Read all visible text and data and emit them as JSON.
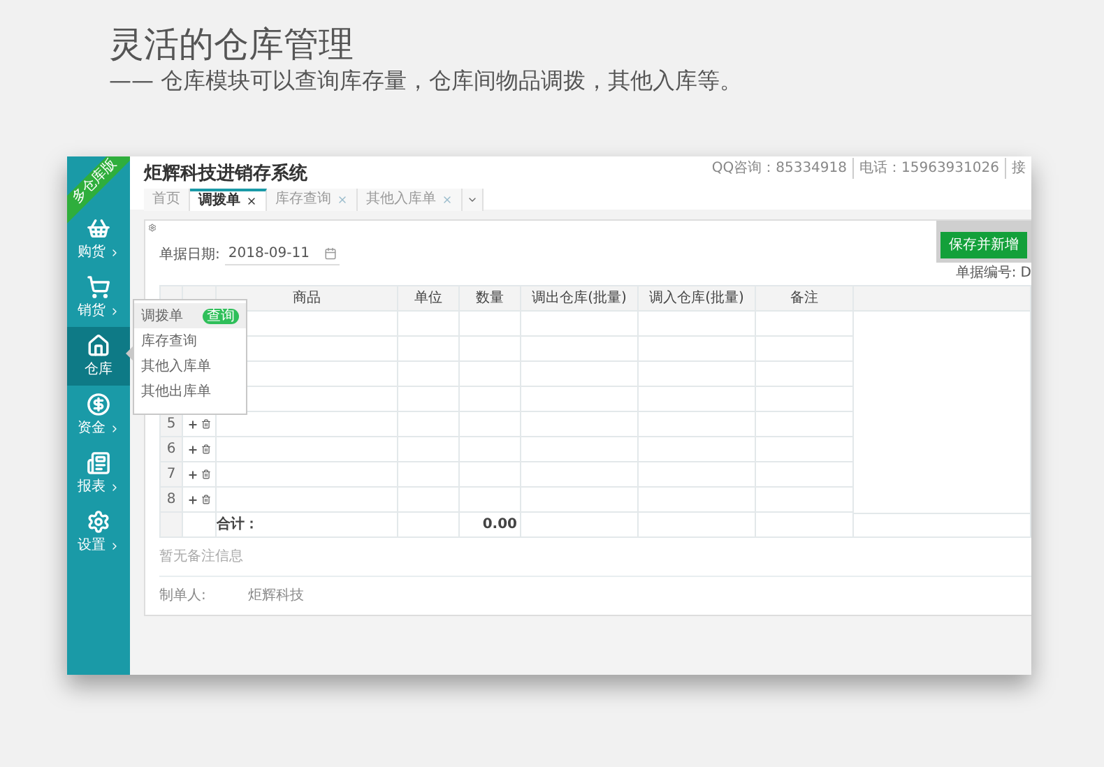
{
  "header": {
    "title": "灵活的仓库管理",
    "subtitle": "—— 仓库模块可以查询库存量，仓库间物品调拨，其他入库等。"
  },
  "app": {
    "badge": "多仓库版",
    "title": "炬辉科技进销存系统",
    "contacts": [
      "QQ咨询：85334918",
      "电话：15963931026",
      "接"
    ]
  },
  "sidebar": [
    {
      "label": "购货",
      "kind": "basket",
      "selected": false
    },
    {
      "label": "销货",
      "kind": "cart",
      "selected": false
    },
    {
      "label": "仓库",
      "kind": "house",
      "selected": true
    },
    {
      "label": "资金",
      "kind": "money",
      "selected": false
    },
    {
      "label": "报表",
      "kind": "report",
      "selected": false
    },
    {
      "label": "设置",
      "kind": "settings",
      "selected": false
    }
  ],
  "menu": [
    {
      "label": "调拨单",
      "selected": true,
      "badge": "查询"
    },
    {
      "label": "库存查询",
      "selected": false
    },
    {
      "label": "其他入库单",
      "selected": false
    },
    {
      "label": "其他出库单",
      "selected": false
    }
  ],
  "tabs": [
    {
      "label": "首页",
      "selected": false,
      "closable": false
    },
    {
      "label": "调拨单",
      "selected": true,
      "closable": true
    },
    {
      "label": "库存查询",
      "selected": false,
      "closable": true
    },
    {
      "label": "其他入库单",
      "selected": false,
      "closable": true
    }
  ],
  "form": {
    "date_label": "单据日期:",
    "date": "2018-09-11",
    "save_button": "保存并新增",
    "number_label": "单据编号:",
    "number": "D"
  },
  "table": {
    "columns": [
      "商品",
      "单位",
      "数量",
      "调出仓库(批量)",
      "调入仓库(批量)",
      "备注"
    ],
    "rows": [
      {
        "kind": "covered"
      },
      {
        "kind": "covered"
      },
      {
        "kind": "covered"
      },
      {
        "kind": "covered"
      },
      {
        "kind": "item",
        "number": "5"
      },
      {
        "kind": "item",
        "number": "6"
      },
      {
        "kind": "item",
        "number": "7"
      },
      {
        "kind": "item",
        "number": "8"
      }
    ],
    "total": {
      "label": "合计：",
      "quantity": "0.00"
    }
  },
  "remark": "暂无备注信息",
  "creator": {
    "label": "制单人:",
    "value": "炬辉科技"
  }
}
